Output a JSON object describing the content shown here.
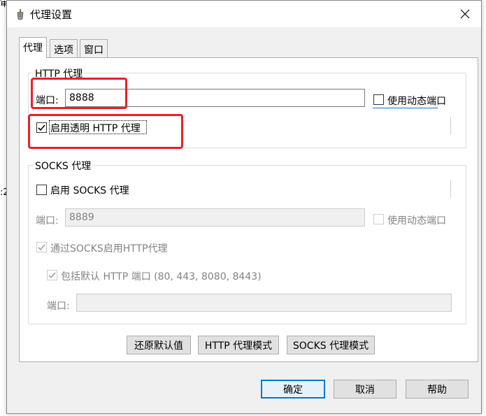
{
  "background": {
    "fragment_top": "审",
    "fragment_side": ":2"
  },
  "window": {
    "title": "代理设置",
    "icon": "pepper-app-icon"
  },
  "tabs": [
    {
      "label": "代理",
      "active": true
    },
    {
      "label": "选项",
      "active": false
    },
    {
      "label": "窗口",
      "active": false
    }
  ],
  "http_proxy": {
    "group_title": "HTTP 代理",
    "port_label": "端口:",
    "port_value": "8888",
    "dynamic_port_label": "使用动态端口",
    "dynamic_port_checked": false,
    "transparent_label": "启用透明 HTTP 代理",
    "transparent_checked": true
  },
  "socks_proxy": {
    "group_title": "SOCKS 代理",
    "enable_label": "启用 SOCKS 代理",
    "enable_checked": false,
    "port_label": "端口:",
    "port_value": "8889",
    "dynamic_port_label": "使用动态端口",
    "dynamic_port_checked": false,
    "http_via_socks_label": "通过SOCKS启用HTTP代理",
    "http_via_socks_checked": true,
    "include_default_label": "包括默认 HTTP 端口 (80, 443, 8080, 8443)",
    "include_default_checked": true,
    "extra_port_label": "端口:",
    "extra_port_value": ""
  },
  "mode_buttons": {
    "restore_defaults": "还原默认值",
    "http_mode": "HTTP 代理模式",
    "socks_mode": "SOCKS 代理模式"
  },
  "footer": {
    "ok": "确定",
    "cancel": "取消",
    "help": "帮助"
  },
  "colors": {
    "annotation": "#e8202a",
    "accent": "#0078d7",
    "disabled_text": "#838383"
  }
}
